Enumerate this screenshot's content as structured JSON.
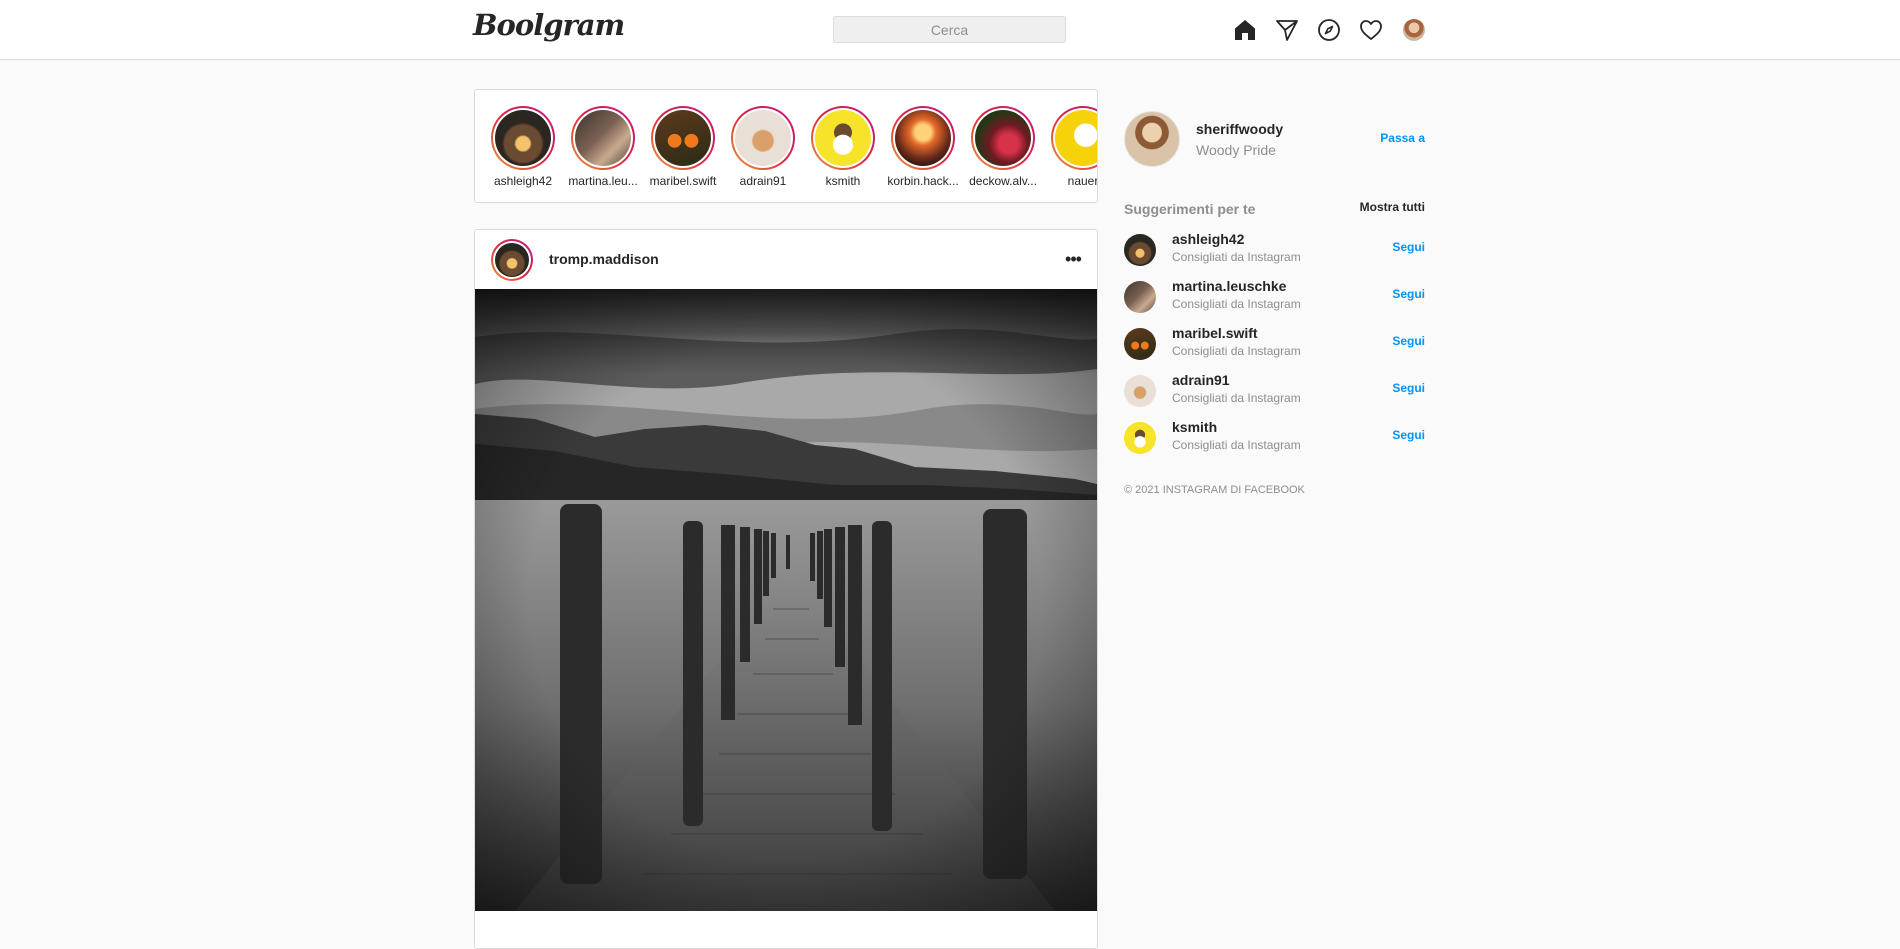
{
  "header": {
    "logo": "Boolgram",
    "search_placeholder": "Cerca",
    "nav_icons": [
      "home-icon",
      "direct-message-icon",
      "explore-compass-icon",
      "activity-heart-icon",
      "profile-avatar"
    ]
  },
  "stories": [
    {
      "username": "ashleigh42"
    },
    {
      "username": "martina.leu..."
    },
    {
      "username": "maribel.swift"
    },
    {
      "username": "adrain91"
    },
    {
      "username": "ksmith"
    },
    {
      "username": "korbin.hack..."
    },
    {
      "username": "deckow.alv..."
    },
    {
      "username": "nauer"
    }
  ],
  "post": {
    "username": "tromp.maddison",
    "more_icon": "more-options-icon",
    "photo_description_icon": "lake-pier-photo"
  },
  "sidebar": {
    "profile": {
      "username": "sheriffwoody",
      "full_name": "Woody Pride",
      "switch_label": "Passa a"
    },
    "suggestions_title": "Suggerimenti per te",
    "show_all_label": "Mostra tutti",
    "suggestions": [
      {
        "username": "ashleigh42",
        "subtitle": "Consigliati da Instagram",
        "follow": "Segui"
      },
      {
        "username": "martina.leuschke",
        "subtitle": "Consigliati da Instagram",
        "follow": "Segui"
      },
      {
        "username": "maribel.swift",
        "subtitle": "Consigliati da Instagram",
        "follow": "Segui"
      },
      {
        "username": "adrain91",
        "subtitle": "Consigliati da Instagram",
        "follow": "Segui"
      },
      {
        "username": "ksmith",
        "subtitle": "Consigliati da Instagram",
        "follow": "Segui"
      }
    ],
    "copyright": "© 2021 INSTAGRAM DI FACEBOOK"
  },
  "colors": {
    "link_blue": "#0095f6",
    "border": "#dbdbdb",
    "background": "#fafafa",
    "muted_text": "#8e8e8e"
  }
}
